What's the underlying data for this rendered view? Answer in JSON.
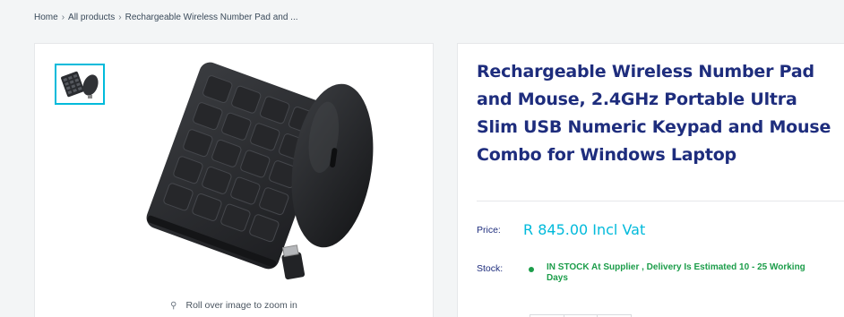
{
  "breadcrumb": {
    "home": "Home",
    "separator": "›",
    "all_products": "All products",
    "current": "Rechargeable Wireless Number Pad and ..."
  },
  "gallery": {
    "zoom_hint": "Roll over image to zoom in",
    "zoom_icon": "search-icon"
  },
  "product": {
    "title": "Rechargeable Wireless Number Pad and Mouse, 2.4GHz Portable Ultra Slim USB Numeric Keypad and Mouse Combo for Windows Laptop",
    "price_label": "Price:",
    "price_value": "R 845.00 Incl Vat",
    "stock_label": "Stock:",
    "stock_value": "IN STOCK At Supplier , Delivery Is Estimated 10 - 25 Working Days"
  },
  "colors": {
    "accent": "#00badb",
    "title": "#1e2d7d",
    "in_stock": "#1c9d4a"
  }
}
